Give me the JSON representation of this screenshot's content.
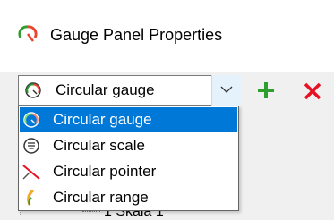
{
  "window": {
    "title": "Gauge Panel Properties"
  },
  "combo": {
    "selected": "Circular gauge"
  },
  "toolbar": {
    "add_label": "+",
    "delete_label": "X"
  },
  "dropdown": {
    "items": [
      {
        "label": "Circular gauge",
        "icon": "circular-gauge-icon",
        "selected": true
      },
      {
        "label": "Circular scale",
        "icon": "circular-scale-icon",
        "selected": false
      },
      {
        "label": "Circular pointer",
        "icon": "circular-pointer-icon",
        "selected": false
      },
      {
        "label": "Circular range",
        "icon": "circular-range-icon",
        "selected": false
      }
    ]
  },
  "tree": {
    "partial_row": "1 Skala 1"
  },
  "colors": {
    "selection": "#0078d7",
    "add_green": "#2e9e2e",
    "delete_red": "#e81123"
  }
}
